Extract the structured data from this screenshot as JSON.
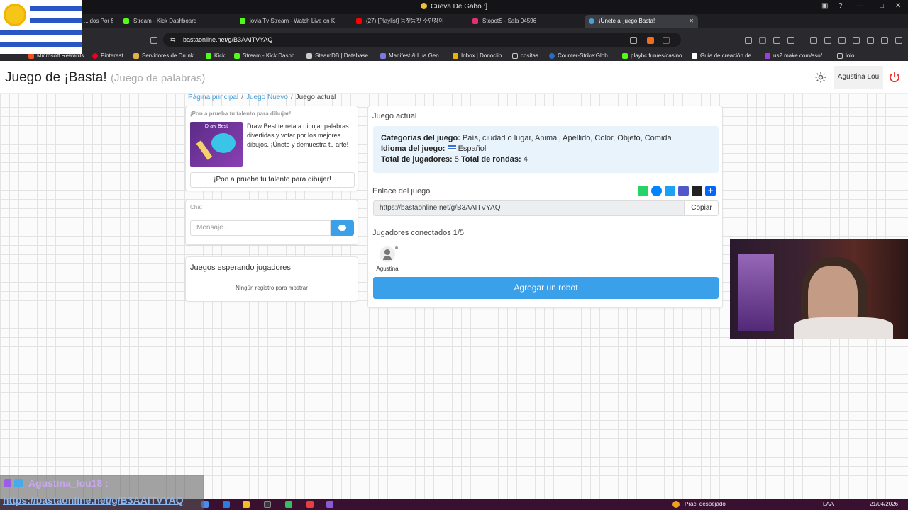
{
  "window": {
    "title": "Cueva De Gabo :]"
  },
  "tabs": [
    {
      "label": "...idos Por S...",
      "color": "#888888"
    },
    {
      "label": "Stream - Kick Dashboard",
      "color": "#53fc18"
    },
    {
      "label": "jovialTv Stream - Watch Live on K",
      "color": "#53fc18"
    },
    {
      "label": "(27) [Playlist] 둥칫둥칫 주인장이",
      "color": "#ff0000"
    },
    {
      "label": "StopotS - Sala 04596",
      "color": "#e0316b"
    },
    {
      "label": "¡Únete al juego Basta!",
      "color": "#4a9fd8",
      "active": true
    }
  ],
  "address": {
    "url": "bastaonline.net/g/B3AAITVYAQ"
  },
  "bookmarks": [
    {
      "label": "Microsoft Rewards",
      "color": "#f25022"
    },
    {
      "label": "Pinterest",
      "color": "#e60023"
    },
    {
      "label": "Servidores de Drunk...",
      "color": "#e3b341"
    },
    {
      "label": "Kick",
      "color": "#53fc18"
    },
    {
      "label": "Stream - Kick Dashb...",
      "color": "#53fc18"
    },
    {
      "label": "SteamDB | Database...",
      "color": "#cccccc"
    },
    {
      "label": "Manifest & Lua Gen...",
      "color": "#7a7adf"
    },
    {
      "label": "Inbox | Donoclip",
      "color": "#e8b400"
    },
    {
      "label": "cositas",
      "color": "#c8c8c8"
    },
    {
      "label": "Counter-Strike:Glob...",
      "color": "#2a6cb5"
    },
    {
      "label": "playbc.fun/es/casino",
      "color": "#53fc18"
    },
    {
      "label": "Guía de creación de...",
      "color": "#ffffff"
    },
    {
      "label": "us2.make.com/sso/...",
      "color": "#9b3fd6"
    },
    {
      "label": "lolo",
      "color": "#c8c8c8"
    }
  ],
  "app": {
    "brand": "Juego de ¡Basta!",
    "brand_sub": "(Juego de palabras)",
    "username": "Agustina Lou"
  },
  "breadcrumb": {
    "home": "Página principal",
    "new": "Juego Nuevo",
    "current": "Juego actual"
  },
  "promo": {
    "title": "¡Pon a prueba tu talento para dibujar!",
    "image_label": "Draw Best",
    "text": "Draw Best te reta a dibujar palabras divertidas y votar por los mejores dibujos. ¡Únete y demuestra tu arte!",
    "button": "¡Pon a prueba tu talento para dibujar!"
  },
  "chat": {
    "label": "Chat",
    "placeholder": "Mensaje..."
  },
  "waiting": {
    "title": "Juegos esperando jugadores",
    "empty": "Ningún registro para mostrar"
  },
  "game": {
    "title": "Juego actual",
    "categories_label": "Categorías del juego:",
    "categories": "País, ciudad o lugar, Animal, Apellido, Color, Objeto, Comida",
    "language_label": "Idioma del juego:",
    "language": "Español",
    "players_label": "Total de jugadores:",
    "players": "5",
    "rounds_label": "Total de rondas:",
    "rounds": "4",
    "link_title": "Enlace del juego",
    "link": "https://bastaonline.net/g/B3AAITVYAQ",
    "copy": "Copiar",
    "connected_title": "Jugadores conectados 1/5",
    "player_name": "Agustina",
    "robot_button": "Agregar un robot",
    "share_icons": [
      {
        "name": "whatsapp-icon",
        "color": "#25d366"
      },
      {
        "name": "messenger-icon",
        "color": "#0084ff"
      },
      {
        "name": "twitter-icon",
        "color": "#1da1f2"
      },
      {
        "name": "teams-icon",
        "color": "#5059c9"
      },
      {
        "name": "snapchat-icon",
        "color": "#222222"
      },
      {
        "name": "add-share-icon",
        "color": "#0166ff"
      }
    ]
  },
  "overlay": {
    "chat_nick": "Agustina_lou18 :",
    "chat_msg": "https://bastaonline.net/g/B3AAITVYAQ"
  },
  "taskbar": {
    "weather": "Prac. despejado",
    "lang": "LAA",
    "date": "21/04/2026"
  }
}
